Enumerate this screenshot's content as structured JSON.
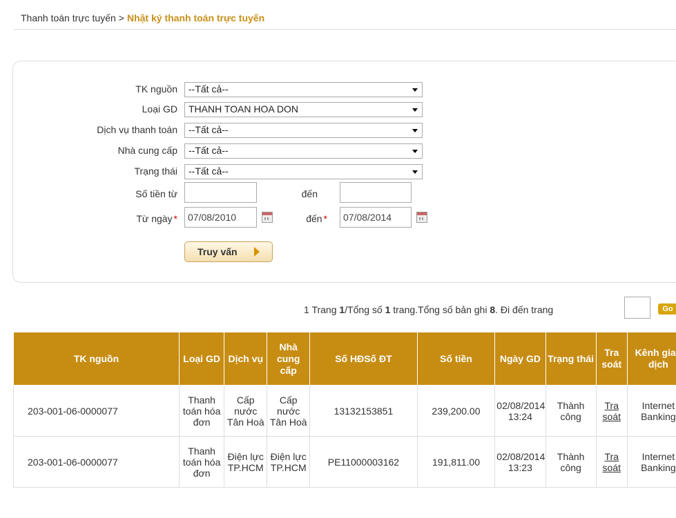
{
  "breadcrumb": {
    "parent": "Thanh toán trực tuyến",
    "separator": ">",
    "current": "Nhật ký thanh toán trực tuyến"
  },
  "filters": {
    "tk_nguon": {
      "label": "TK nguồn",
      "value": "--Tất cả--"
    },
    "loai_gd": {
      "label": "Loại GD",
      "value": "THANH TOAN HOA DON"
    },
    "dich_vu": {
      "label": "Dịch vụ thanh toán",
      "value": "--Tất cả--"
    },
    "nha_cung_cap": {
      "label": "Nhà cung cấp",
      "value": "--Tất cả--"
    },
    "trang_thai": {
      "label": "Trạng thái",
      "value": "--Tất cả--"
    },
    "so_tien_tu": {
      "label": "Số tiền từ",
      "value": ""
    },
    "so_tien_den": {
      "label": "đến",
      "value": ""
    },
    "tu_ngay": {
      "label": "Từ ngày",
      "required": "*",
      "value": "07/08/2010"
    },
    "den_ngay": {
      "label": "đến",
      "required": "*",
      "value": "07/08/2014"
    },
    "query_button": "Truy vấn"
  },
  "pager": {
    "page": "1",
    "page_label": "Trang",
    "current": "1",
    "total_label": "/Tổng số",
    "total_pages": "1",
    "records_label": "trang.Tổng số bản ghi",
    "records": "8",
    "goto_label": ". Đi đến trang",
    "go_button": "Go"
  },
  "table": {
    "headers": [
      "TK nguồn",
      "Loại GD",
      "Dịch vụ",
      "Nhà cung cấp",
      "Số HĐSố ĐT",
      "Số tiền",
      "Ngày GD",
      "Trạng thái",
      "Tra soát",
      "Kênh giao dịch"
    ],
    "rows": [
      {
        "tk_nguon": "203-001-06-0000077",
        "loai_gd": "Thanh toán hóa đơn",
        "dich_vu": "Cấp nước Tân Hoà",
        "nha_cung_cap": "Cấp nước Tân Hoà",
        "so_hd": "13132153851",
        "so_tien": "239,200.00",
        "ngay_gd": "02/08/2014 13:24",
        "trang_thai": "Thành công",
        "tra_soat": "Tra soát",
        "kenh": "Internet Banking"
      },
      {
        "tk_nguon": "203-001-06-0000077",
        "loai_gd": "Thanh toán hóa đơn",
        "dich_vu": "Điện lực TP.HCM",
        "nha_cung_cap": "Điện lực TP.HCM",
        "so_hd": "PE11000003162",
        "so_tien": "191,811.00",
        "ngay_gd": "02/08/2014 13:23",
        "trang_thai": "Thành công",
        "tra_soat": "Tra soát",
        "kenh": "Internet Banking"
      }
    ]
  }
}
